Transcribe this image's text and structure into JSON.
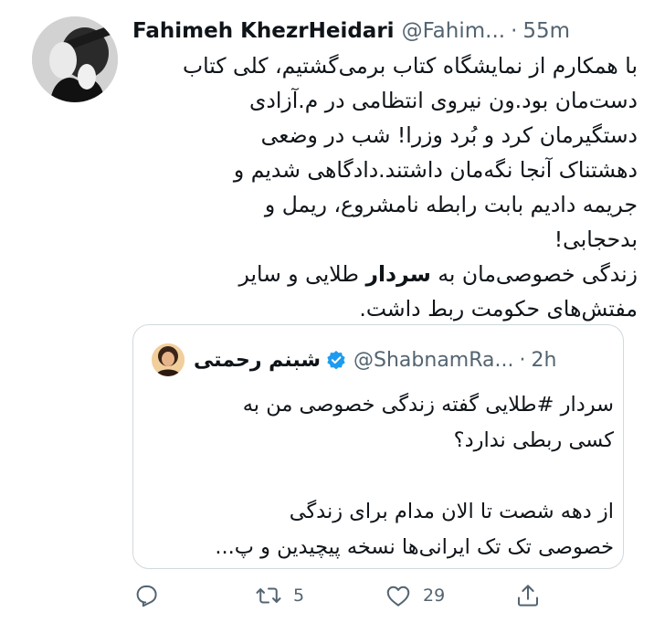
{
  "tweet": {
    "author_name": "Fahimeh KhezrHeidari",
    "author_handle": "@Fahim...",
    "separator": "·",
    "time": "55m",
    "lines": [
      "با همکارم از نمایشگاه کتاب برمی‌گشتیم، کلی کتاب",
      "دست‌مان بود.ون نیروی انتظامی در م.آزادی",
      "دستگیرمان کرد و بُرد وزرا! شب در وضعی",
      "دهشتناک آنجا نگه‌مان داشتند.دادگاهی شدیم و",
      "جریمه دادیم بابت رابطه نامشروع، ریمل و",
      "بدحجابی!"
    ],
    "last_line_pre": "زندگی خصوصی‌مان به ",
    "last_line_bold": "سردار",
    "last_line_post": " طلایی و سایر",
    "final_line": "مفتش‌های حکومت ربط داشت."
  },
  "quote": {
    "author_name": "شبنم رحمتی",
    "author_handle": "@ShabnamRa...",
    "separator": "·",
    "time": "2h",
    "verified_color": "#1d9bf0",
    "para1_line1": "سردار #طلایی گفته زندگی خصوصی من به",
    "para1_line2": "کسی ربطی ندارد؟",
    "para2_line1": "از دهه شصت تا الان مدام برای زندگی",
    "para2_line2": "خصوصی تک تک ایرانی‌ها نسخه پیچیدین و پ..."
  },
  "actions": {
    "reply_icon": "reply-icon",
    "retweet_icon": "retweet-icon",
    "retweet_count": "5",
    "like_icon": "heart-icon",
    "like_count": "29",
    "share_icon": "share-icon"
  },
  "colors": {
    "text": "#0f1419",
    "secondary": "#536471",
    "border": "#cfd9de"
  }
}
